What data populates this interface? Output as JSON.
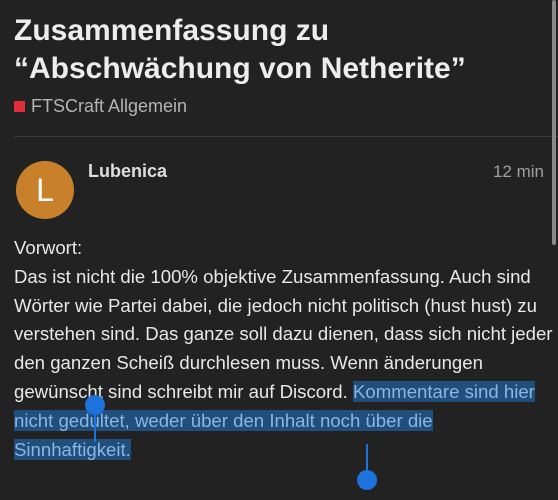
{
  "topic": {
    "title": "Zusammenfassung zu “Abschwächung von Netherite”",
    "category": "FTSCraft Allgemein",
    "category_color": "#e12d39"
  },
  "post": {
    "avatar_letter": "L",
    "avatar_color": "#c9802a",
    "username": "Lubenica",
    "time": "12 min",
    "heading": "Vorwort:",
    "text_before_selection": "Das ist nicht die 100% objektive Zusammenfassung. Auch sind Wörter wie Partei dabei, die jedoch nicht politisch (hust hust) zu verstehen sind. Das ganze soll dazu dienen, dass sich nicht jeder den ganzen Scheiß durchlesen muss. Wenn änderungen gewünscht sind schreibt mir auf Discord. ",
    "selected_text": "Kommentare sind hier nicht gedultet, weder über den Inhalt noch über die Sinnhaftigkeit."
  },
  "selection_color": "#1e72db"
}
